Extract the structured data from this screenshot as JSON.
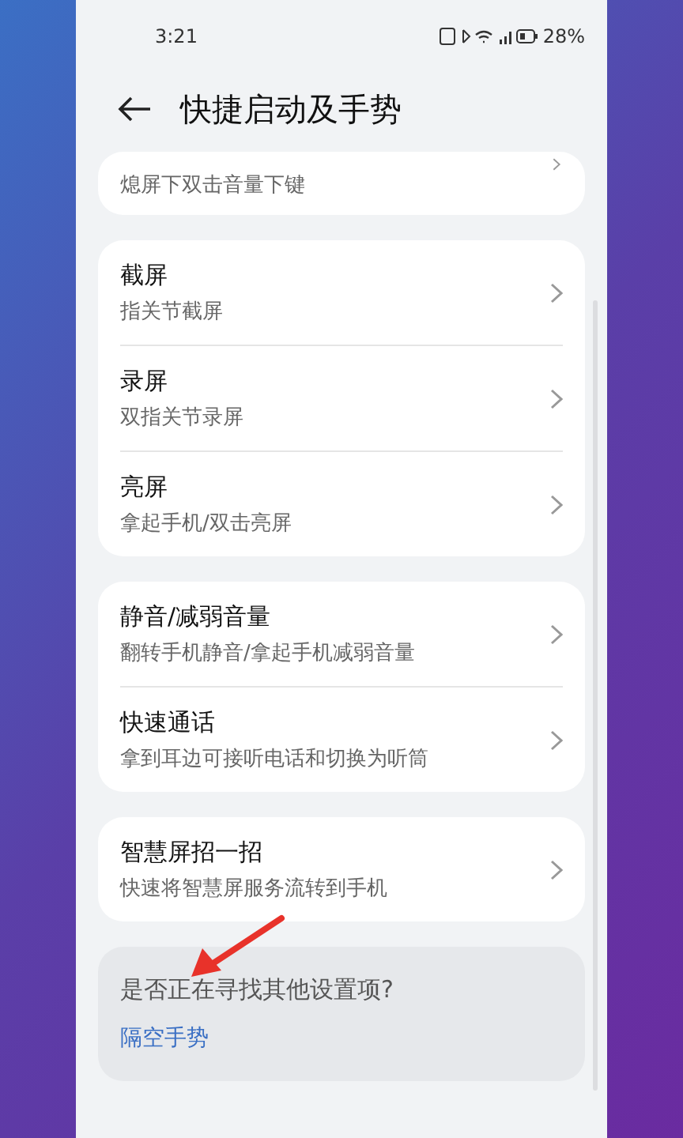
{
  "status_bar": {
    "time": "3:21",
    "battery": "28%"
  },
  "header": {
    "title": "快捷启动及手势"
  },
  "partial_card": {
    "subtitle": "熄屏下双击音量下键"
  },
  "groups": [
    {
      "items": [
        {
          "title": "截屏",
          "subtitle": "指关节截屏"
        },
        {
          "title": "录屏",
          "subtitle": "双指关节录屏"
        },
        {
          "title": "亮屏",
          "subtitle": "拿起手机/双击亮屏"
        }
      ]
    },
    {
      "items": [
        {
          "title": "静音/减弱音量",
          "subtitle": "翻转手机静音/拿起手机减弱音量"
        },
        {
          "title": "快速通话",
          "subtitle": "拿到耳边可接听电话和切换为听筒"
        }
      ]
    },
    {
      "items": [
        {
          "title": "智慧屏招一招",
          "subtitle": "快速将智慧屏服务流转到手机"
        }
      ]
    }
  ],
  "suggestion": {
    "question": "是否正在寻找其他设置项?",
    "link": "隔空手势"
  }
}
